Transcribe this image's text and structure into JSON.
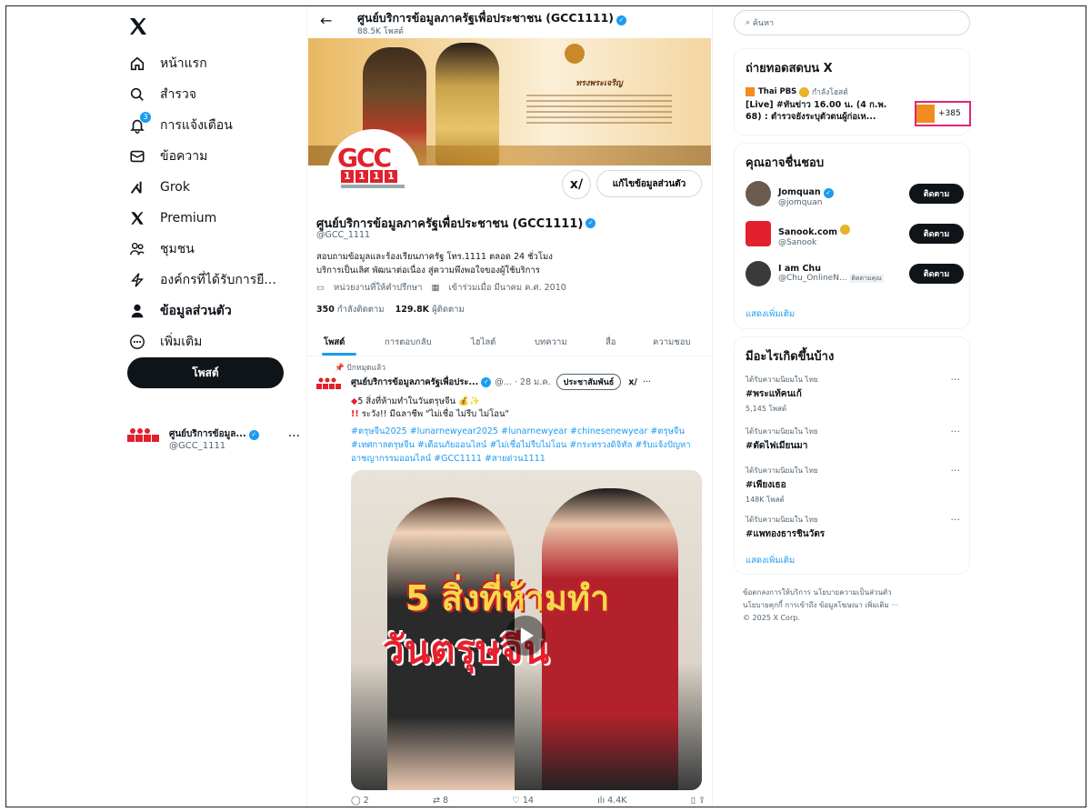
{
  "nav": {
    "items": [
      {
        "label": "หน้าแรก",
        "icon": "home-icon"
      },
      {
        "label": "สำรวจ",
        "icon": "search-icon"
      },
      {
        "label": "การแจ้งเตือน",
        "icon": "bell-icon",
        "badge": "3"
      },
      {
        "label": "ข้อความ",
        "icon": "mail-icon"
      },
      {
        "label": "Grok",
        "icon": "grok-icon"
      },
      {
        "label": "Premium",
        "icon": "x-logo-icon"
      },
      {
        "label": "ชุมชน",
        "icon": "people-icon"
      },
      {
        "label": "องค์กรที่ได้รับการยื...",
        "icon": "lightning-icon"
      },
      {
        "label": "ข้อมูลส่วนตัว",
        "icon": "person-icon"
      },
      {
        "label": "เพิ่มเติม",
        "icon": "more-circle-icon"
      }
    ],
    "post_label": "โพสต์",
    "account": {
      "name": "ศูนย์บริการข้อมูล...",
      "handle": "@GCC_1111",
      "more": "···"
    }
  },
  "header": {
    "title": "ศูนย์บริการข้อมูลภาครัฐเพื่อประชาชน (GCC1111)",
    "subtitle": "88.5K โพสต์"
  },
  "banner": {
    "text": "ทรงพระเจริญ"
  },
  "profile": {
    "edit_label": "แก้ไขข้อมูลส่วนตัว",
    "name": "ศูนย์บริการข้อมูลภาครัฐเพื่อประชาชน (GCC1111)",
    "handle": "@GCC_1111",
    "bio_line1": "สอบถามข้อมูลและร้องเรียนภาครัฐ โทร.1111 ตลอด 24 ชั่วโมง",
    "bio_line2": "บริการเป็นเลิศ พัฒนาต่อเนื่อง สู่ความพึงพอใจของผู้ใช้บริการ",
    "category": "หน่วยงานที่ให้คำปรึกษา",
    "joined": "เข้าร่วมเมื่อ มีนาคม ค.ศ. 2010",
    "following_count": "350",
    "following_label": "กำลังติดตาม",
    "followers_count": "129.8K",
    "followers_label": "ผู้ติดตาม",
    "avatar_text": "GCC",
    "avatar_num": [
      "1",
      "1",
      "1",
      "1"
    ]
  },
  "tabs": [
    "โพสต์",
    "การตอบกลับ",
    "ไฮไลต์",
    "บทความ",
    "สื่อ",
    "ความชอบ"
  ],
  "tweet": {
    "pinned": "ปักหมุดแล้ว",
    "name": "ศูนย์บริการข้อมูลภาครัฐเพื่อประ...",
    "meta": "@... · 28 ม.ค.",
    "tag": "ประชาสัมพันธ์",
    "line1": "5 สิ่งที่ห้ามทำในวันตรุษจีน",
    "line2": "ระวัง!! มีฉลาชีพ \"ไม่เชื่อ ไม่รีบ ไม่โอน\"",
    "hashtags": "#ตรุษจีน2025 #lunarnewyear2025 #lunarnewyear #chinesenewyear #ตรุษจีน #เทศกาลตรุษจีน #เตือนภัยออนไลน์ #ไม่เชื่อไม่รีบไม่โอน #กระทรวงดิจิทัล #รับแจ้งปัญหาอาชญากรรมออนไลน์ #GCC1111 #สายด่วน1111",
    "media_text1": "5 สิ่งที่ห้ามทำ",
    "media_text2": "วันตรุษจีน",
    "replies": "2",
    "reposts": "8",
    "likes": "14",
    "views": "4.4K"
  },
  "right": {
    "search_placeholder": "ค้นหา",
    "live": {
      "title": "ถ่ายทอดสดบน X",
      "source": "Thai PBS",
      "status": "กำลังโฮสต์",
      "text": "[Live] #ทันข่าว 16.00 น. (4 ก.พ. 68) : ตำรวจยังระบุตัวตนผู้ก่อเห...",
      "count": "+385"
    },
    "who": {
      "title": "คุณอาจชื่นชอบ",
      "users": [
        {
          "name": "Jomquan",
          "handle": "@jomquan",
          "follow": "ติดตาม"
        },
        {
          "name": "Sanook.com",
          "handle": "@Sanook",
          "follow": "ติดตาม"
        },
        {
          "name": "I am Chu",
          "handle": "@Chu_OnlineN...",
          "note": "ติดตามคุณ",
          "follow": "ติดตาม"
        }
      ],
      "show_more": "แสดงเพิ่มเติม"
    },
    "trends": {
      "title": "มีอะไรเกิดขึ้นบ้าง",
      "items": [
        {
          "ctx": "ได้รับความนิยมใน ไทย",
          "tag": "#พระแท้คนเก้",
          "count": "5,145 โพสต์"
        },
        {
          "ctx": "ได้รับความนิยมใน ไทย",
          "tag": "#ตัดไฟเมียนมา",
          "count": ""
        },
        {
          "ctx": "ได้รับความนิยมใน ไทย",
          "tag": "#เพียงเธอ",
          "count": "148K โพสต์"
        },
        {
          "ctx": "ได้รับความนิยมใน ไทย",
          "tag": "#แพทองธารชินวัตร",
          "count": ""
        }
      ],
      "show_more": "แสดงเพิ่มเติม"
    },
    "footer_line1": "ข้อตกลงการให้บริการ   นโยบายความเป็นส่วนตัว",
    "footer_line2": "นโยบายคุกกี้   การเข้าถึง   ข้อมูลโฆษณา   เพิ่มเติม ···",
    "footer_line3": "© 2025 X Corp."
  },
  "colors": {
    "accent": "#1d9bf0",
    "text": "#0f1419",
    "muted": "#536471",
    "brand": "#e1212d"
  }
}
